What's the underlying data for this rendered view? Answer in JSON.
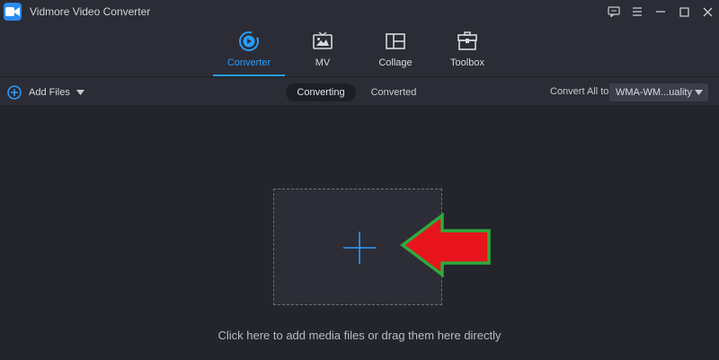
{
  "app": {
    "title": "Vidmore Video Converter",
    "accent": "#2a9dff",
    "logo_icon": "video-camera-icon"
  },
  "window_controls": [
    {
      "icon": "feedback-icon"
    },
    {
      "icon": "menu-icon"
    },
    {
      "icon": "minimize-icon"
    },
    {
      "icon": "maximize-icon"
    },
    {
      "icon": "close-icon"
    }
  ],
  "nav": {
    "tabs": [
      {
        "label": "Converter",
        "icon": "converter-icon",
        "active": true
      },
      {
        "label": "MV",
        "icon": "mv-icon",
        "active": false
      },
      {
        "label": "Collage",
        "icon": "collage-icon",
        "active": false
      },
      {
        "label": "Toolbox",
        "icon": "toolbox-icon",
        "active": false
      }
    ]
  },
  "toolbar": {
    "add_files_label": "Add Files",
    "segments": [
      {
        "label": "Converting",
        "active": true
      },
      {
        "label": "Converted",
        "active": false
      }
    ],
    "convert_all_label": "Convert All to:",
    "format_value": "WMA-WM...uality"
  },
  "dropzone": {
    "hint": "Click here to add media files or drag them here directly",
    "plus_color": "#2a9dff",
    "arrow_fill": "#e8141b",
    "arrow_outline": "#2faa3c"
  }
}
